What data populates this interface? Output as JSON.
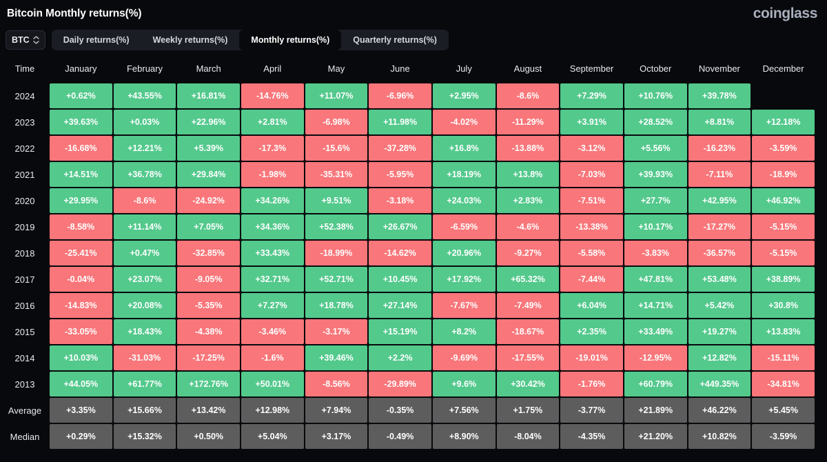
{
  "header": {
    "title": "Bitcoin Monthly returns(%)",
    "brand": "coinglass"
  },
  "toolbar": {
    "asset": "BTC",
    "asset_icon": "chevron-up-down-icon",
    "tabs": [
      {
        "label": "Daily returns(%)",
        "active": false
      },
      {
        "label": "Weekly returns(%)",
        "active": false
      },
      {
        "label": "Monthly returns(%)",
        "active": true
      },
      {
        "label": "Quarterly returns(%)",
        "active": false
      }
    ]
  },
  "colors": {
    "positive": "#53c98c",
    "negative": "#f9767a",
    "stat": "#5d5d5d",
    "background": "#08090c",
    "tab_bar": "#1a1d24"
  },
  "table": {
    "columns": [
      "Time",
      "January",
      "February",
      "March",
      "April",
      "May",
      "June",
      "July",
      "August",
      "September",
      "October",
      "November",
      "December"
    ],
    "rows": [
      {
        "label": "2024",
        "kind": "year",
        "values": [
          "+0.62%",
          "+43.55%",
          "+16.81%",
          "-14.76%",
          "+11.07%",
          "-6.96%",
          "+2.95%",
          "-8.6%",
          "+7.29%",
          "+10.76%",
          "+39.78%",
          ""
        ]
      },
      {
        "label": "2023",
        "kind": "year",
        "values": [
          "+39.63%",
          "+0.03%",
          "+22.96%",
          "+2.81%",
          "-6.98%",
          "+11.98%",
          "-4.02%",
          "-11.29%",
          "+3.91%",
          "+28.52%",
          "+8.81%",
          "+12.18%"
        ]
      },
      {
        "label": "2022",
        "kind": "year",
        "values": [
          "-16.68%",
          "+12.21%",
          "+5.39%",
          "-17.3%",
          "-15.6%",
          "-37.28%",
          "+16.8%",
          "-13.88%",
          "-3.12%",
          "+5.56%",
          "-16.23%",
          "-3.59%"
        ]
      },
      {
        "label": "2021",
        "kind": "year",
        "values": [
          "+14.51%",
          "+36.78%",
          "+29.84%",
          "-1.98%",
          "-35.31%",
          "-5.95%",
          "+18.19%",
          "+13.8%",
          "-7.03%",
          "+39.93%",
          "-7.11%",
          "-18.9%"
        ]
      },
      {
        "label": "2020",
        "kind": "year",
        "values": [
          "+29.95%",
          "-8.6%",
          "-24.92%",
          "+34.26%",
          "+9.51%",
          "-3.18%",
          "+24.03%",
          "+2.83%",
          "-7.51%",
          "+27.7%",
          "+42.95%",
          "+46.92%"
        ]
      },
      {
        "label": "2019",
        "kind": "year",
        "values": [
          "-8.58%",
          "+11.14%",
          "+7.05%",
          "+34.36%",
          "+52.38%",
          "+26.67%",
          "-6.59%",
          "-4.6%",
          "-13.38%",
          "+10.17%",
          "-17.27%",
          "-5.15%"
        ]
      },
      {
        "label": "2018",
        "kind": "year",
        "values": [
          "-25.41%",
          "+0.47%",
          "-32.85%",
          "+33.43%",
          "-18.99%",
          "-14.62%",
          "+20.96%",
          "-9.27%",
          "-5.58%",
          "-3.83%",
          "-36.57%",
          "-5.15%"
        ]
      },
      {
        "label": "2017",
        "kind": "year",
        "values": [
          "-0.04%",
          "+23.07%",
          "-9.05%",
          "+32.71%",
          "+52.71%",
          "+10.45%",
          "+17.92%",
          "+65.32%",
          "-7.44%",
          "+47.81%",
          "+53.48%",
          "+38.89%"
        ]
      },
      {
        "label": "2016",
        "kind": "year",
        "values": [
          "-14.83%",
          "+20.08%",
          "-5.35%",
          "+7.27%",
          "+18.78%",
          "+27.14%",
          "-7.67%",
          "-7.49%",
          "+6.04%",
          "+14.71%",
          "+5.42%",
          "+30.8%"
        ]
      },
      {
        "label": "2015",
        "kind": "year",
        "values": [
          "-33.05%",
          "+18.43%",
          "-4.38%",
          "-3.46%",
          "-3.17%",
          "+15.19%",
          "+8.2%",
          "-18.67%",
          "+2.35%",
          "+33.49%",
          "+19.27%",
          "+13.83%"
        ]
      },
      {
        "label": "2014",
        "kind": "year",
        "values": [
          "+10.03%",
          "-31.03%",
          "-17.25%",
          "-1.6%",
          "+39.46%",
          "+2.2%",
          "-9.69%",
          "-17.55%",
          "-19.01%",
          "-12.95%",
          "+12.82%",
          "-15.11%"
        ]
      },
      {
        "label": "2013",
        "kind": "year",
        "values": [
          "+44.05%",
          "+61.77%",
          "+172.76%",
          "+50.01%",
          "-8.56%",
          "-29.89%",
          "+9.6%",
          "+30.42%",
          "-1.76%",
          "+60.79%",
          "+449.35%",
          "-34.81%"
        ]
      },
      {
        "label": "Average",
        "kind": "stat",
        "values": [
          "+3.35%",
          "+15.66%",
          "+13.42%",
          "+12.98%",
          "+7.94%",
          "-0.35%",
          "+7.56%",
          "+1.75%",
          "-3.77%",
          "+21.89%",
          "+46.22%",
          "+5.45%"
        ]
      },
      {
        "label": "Median",
        "kind": "stat",
        "values": [
          "+0.29%",
          "+15.32%",
          "+0.50%",
          "+5.04%",
          "+3.17%",
          "-0.49%",
          "+8.90%",
          "-8.04%",
          "-4.35%",
          "+21.20%",
          "+10.82%",
          "-3.59%"
        ]
      }
    ]
  }
}
